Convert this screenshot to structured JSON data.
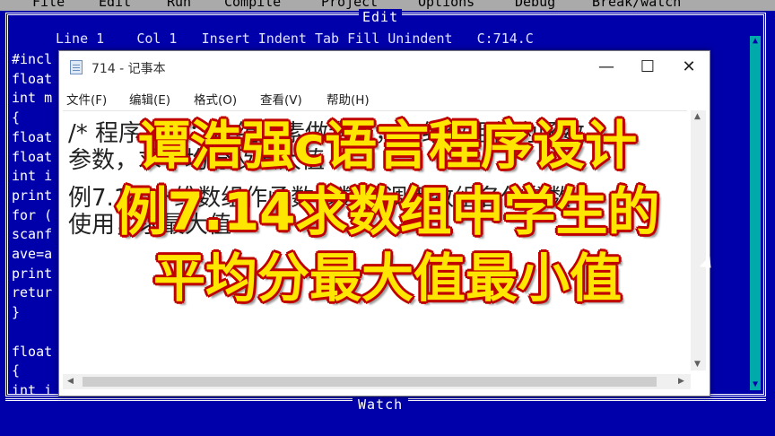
{
  "ide": {
    "menu": [
      "File",
      "Edit",
      "Run",
      "Compile",
      "Project",
      "Options",
      "Debug",
      "Break/watch"
    ],
    "window_title": "Edit",
    "status": {
      "line": "Line 1",
      "col": "Col 1",
      "modes": "Insert Indent Tab Fill Unindent",
      "file": "C:714.C"
    },
    "code_lines": [
      "#incl",
      "float",
      "int m",
      "{",
      "float",
      "float",
      "int i",
      "print",
      "for (",
      "scanf",
      "ave=a",
      "print",
      "retur",
      "}",
      "",
      "float",
      "{",
      "int i"
    ],
    "watch_title": "Watch"
  },
  "notepad": {
    "title": "714 - 记事本",
    "minimize": "—",
    "maximize": "☐",
    "close": "✕",
    "menu": [
      "文件(F)",
      "编辑(E)",
      "格式(O)",
      "查看(V)",
      "帮助(H)"
    ],
    "text_lines": [
      "/* 程序功能：数组元素做参数，一维数组作为函数",
      "   参数，求平均分及最大值 */",
      "例7.14 一维数组作函数参数，调用数组名作参数",
      "   使用，求最大值"
    ]
  },
  "overlay": {
    "line1": "谭浩强c语言程序设计",
    "line2": "例7.14求数组中学生的",
    "line3": "平均分最大值最小值"
  }
}
